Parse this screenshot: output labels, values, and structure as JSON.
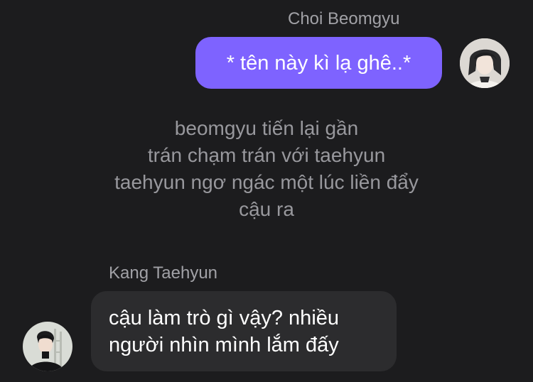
{
  "messages": {
    "right": {
      "sender": "Choi Beomgyu",
      "text": "* tên này kì lạ ghê..*"
    },
    "narration": {
      "lines": [
        "beomgyu tiến lại gần",
        "trán chạm trán với taehyun",
        "taehyun ngơ ngác một lúc liền đẩy",
        "cậu ra"
      ]
    },
    "left": {
      "sender": "Kang Taehyun",
      "lines": [
        "cậu làm trò gì vậy? nhiều",
        "người nhìn mình lắm đấy"
      ]
    }
  },
  "colors": {
    "background": "#1c1c1e",
    "outgoing_bubble": "#7e63ff",
    "incoming_bubble": "#2c2c2e",
    "secondary_text": "#a1a1a6"
  },
  "icons": {
    "avatar_right": "profile-photo",
    "avatar_left": "profile-photo"
  }
}
